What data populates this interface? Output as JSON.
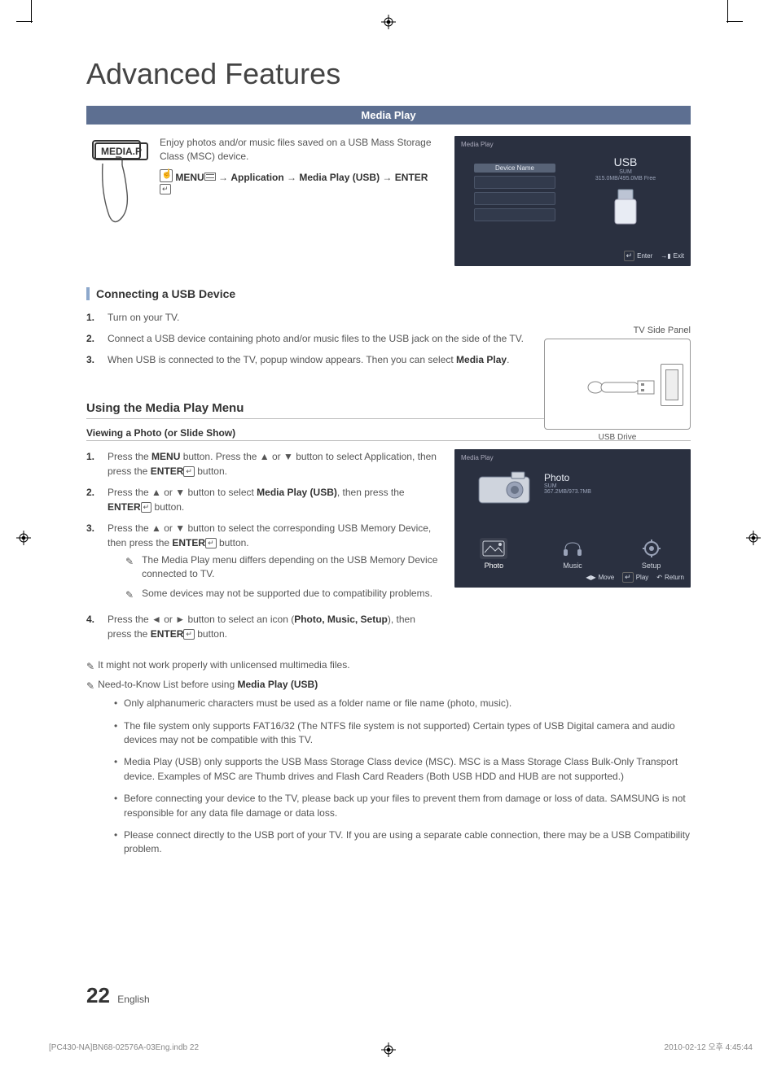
{
  "title": "Advanced Features",
  "section_bar": "Media Play",
  "media_btn": "MEDIA.P",
  "intro": "Enjoy photos and/or music files saved on a USB Mass Storage Class (MSC) device.",
  "path": {
    "menu": "MENU",
    "app": "Application",
    "mp": "Media Play (USB)",
    "enter": "ENTER"
  },
  "screen1": {
    "header": "Media Play",
    "device_name": "Device Name",
    "usb": "USB",
    "sum": "SUM",
    "sizes": "315.0MB/495.0MB Free",
    "enter": "Enter",
    "exit": "Exit"
  },
  "sec_usb": "Connecting a USB Device",
  "usb_steps": [
    "Turn on your TV.",
    "Connect a USB device containing photo and/or music files to the USB jack on the side of the TV.",
    "When USB is connected to the TV, popup window appears. Then you can select "
  ],
  "usb_step3_bold": "Media Play",
  "side_panel": "TV Side Panel",
  "usb_drive": "USB Drive",
  "sec_menu": "Using the Media Play Menu",
  "view_hdr": "Viewing a Photo (or Slide Show)",
  "menu_steps": {
    "s1a": "Press the ",
    "s1b": "MENU",
    "s1c": " button. Press the ▲ or ▼ button to select Application, then press the ",
    "s1d": "ENTER",
    "s1e": " button.",
    "s2a": "Press the ▲ or ▼ button to select ",
    "s2b": "Media Play (USB)",
    "s2c": ", then press the ",
    "s2d": "ENTER",
    "s2e": " button.",
    "s3a": "Press the ▲ or ▼ button to select the corresponding USB Memory Device, then press the ",
    "s3b": "ENTER",
    "s3c": " button.",
    "s4a": "Press the ◄ or ► button to select an icon (",
    "s4b": "Photo, Music, Setup",
    "s4c": "), then press the ",
    "s4d": "ENTER",
    "s4e": " button."
  },
  "s3_notes": [
    "The Media Play menu differs depending on the USB Memory Device connected to TV.",
    "Some devices may not be supported due to compatibility problems."
  ],
  "screen2": {
    "header": "Media Play",
    "title": "Photo",
    "sum": "SUM",
    "sizes": "367.2MB/973.7MB",
    "cats": [
      "Photo",
      "Music",
      "Setup"
    ],
    "move": "Move",
    "play": "Play",
    "ret": "Return"
  },
  "bottom_note1": "It might not work properly with unlicensed multimedia files.",
  "need_to_know_pre": "Need-to-Know List before using ",
  "need_to_know_bold": "Media Play (USB)",
  "bullets": [
    "Only alphanumeric characters must be used as a folder name or file name (photo, music).",
    "The file system only supports FAT16/32 (The NTFS file system is not supported) Certain types of USB Digital camera and audio devices may not be compatible with this TV.",
    "Media Play (USB) only supports the USB Mass Storage Class device (MSC). MSC is a Mass Storage Class Bulk-Only Transport device. Examples of MSC are Thumb drives and Flash Card Readers (Both USB HDD and HUB are not supported.)",
    "Before connecting your device to the TV, please back up your files to prevent them from damage or loss of data. SAMSUNG is not responsible for any data file damage or data loss.",
    "Please connect directly to the USB port of your TV. If you are using a separate cable connection, there may be a USB Compatibility problem."
  ],
  "page_no": "22",
  "lang": "English",
  "meta_left": "[PC430-NA]BN68-02576A-03Eng.indb   22",
  "meta_right": "2010-02-12   오후 4:45:44"
}
